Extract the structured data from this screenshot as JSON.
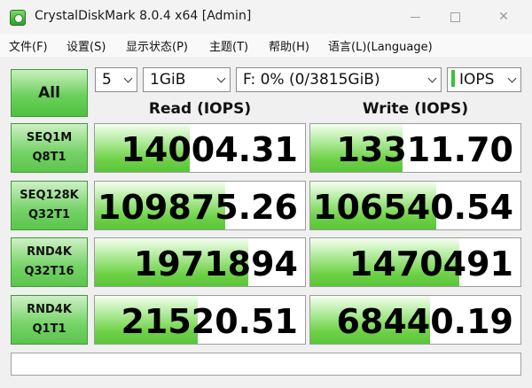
{
  "window": {
    "title": "CrystalDiskMark 8.0.4 x64 [Admin]",
    "minimize": "—",
    "maximize": "☐",
    "close": "✕"
  },
  "menu": [
    "文件(F)",
    "设置(S)",
    "显示状态(P)",
    "主题(T)",
    "帮助(H)",
    "语言(L)(Language)"
  ],
  "toolbar": {
    "all_label": "All",
    "count": "5",
    "size": "1GiB",
    "drive": "F: 0% (0/3815GiB)",
    "unit": "IOPS"
  },
  "headers": {
    "read": "Read (IOPS)",
    "write": "Write (IOPS)"
  },
  "tests": [
    {
      "line1": "SEQ1M",
      "line2": "Q8T1",
      "read": "14004.31",
      "write": "13311.70",
      "read_fill": 0.45,
      "write_fill": 0.44
    },
    {
      "line1": "SEQ128K",
      "line2": "Q32T1",
      "read": "109875.26",
      "write": "106540.54",
      "read_fill": 0.62,
      "write_fill": 0.6
    },
    {
      "line1": "RND4K",
      "line2": "Q32T16",
      "read": "1971894",
      "write": "1470491",
      "read_fill": 0.73,
      "write_fill": 0.71
    },
    {
      "line1": "RND4K",
      "line2": "Q1T1",
      "read": "21520.51",
      "write": "68440.19",
      "read_fill": 0.49,
      "write_fill": 0.57
    }
  ],
  "status": ""
}
